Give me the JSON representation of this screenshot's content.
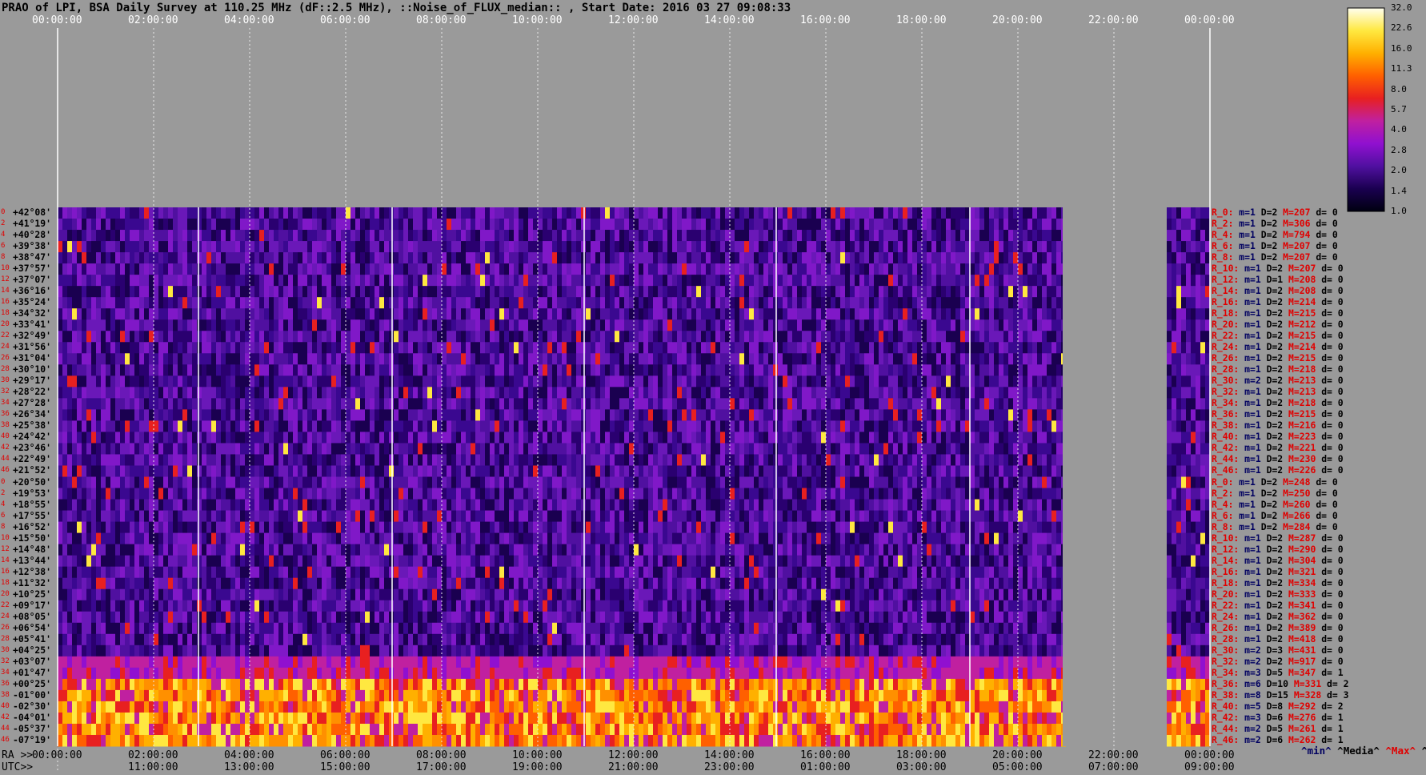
{
  "title": "PRAO of LPI, BSA Daily Survey at 110.25 MHz (dF::2.5 MHz), ::Noise_of_FLUX_median:: , Start Date: 2016 03 27 09:08:33",
  "top_axis": {
    "ticks": [
      "00:00:00",
      "02:00:00",
      "04:00:00",
      "06:00:00",
      "08:00:00",
      "10:00:00",
      "12:00:00",
      "14:00:00",
      "16:00:00",
      "18:00:00",
      "20:00:00",
      "22:00:00",
      "00:00:00"
    ]
  },
  "bottom_axis": {
    "ra_label": "RA >>",
    "utc_label": "UTC>>",
    "ra_ticks": [
      "00:00:00",
      "02:00:00",
      "04:00:00",
      "06:00:00",
      "08:00:00",
      "10:00:00",
      "12:00:00",
      "14:00:00",
      "16:00:00",
      "18:00:00",
      "20:00:00",
      "22:00:00",
      "00:00:00"
    ],
    "utc_ticks": [
      "11:00:00",
      "13:00:00",
      "15:00:00",
      "17:00:00",
      "19:00:00",
      "21:00:00",
      "23:00:00",
      "01:00:00",
      "03:00:00",
      "05:00:00",
      "07:00:00",
      "09:00:00"
    ]
  },
  "colorbar": {
    "ticks": [
      "32.0",
      "22.6",
      "16.0",
      "11.3",
      "8.0",
      "5.7",
      "4.0",
      "2.8",
      "2.0",
      "1.4",
      "1.0"
    ],
    "colors": [
      "#000010",
      "#1a0050",
      "#5010a0",
      "#9010d0",
      "#c020a0",
      "#e82020",
      "#ff6000",
      "#ffb000",
      "#ffe840",
      "#fffff0"
    ]
  },
  "stats_footer": {
    "min": "^min^",
    "median": "^Media^",
    "max": "^Max^",
    "dev": "^devia^"
  },
  "chart_data": {
    "type": "heatmap",
    "title": "PRAO of LPI, BSA Daily Survey at 110.25 MHz (dF::2.5 MHz), ::Noise_of_FLUX_median:: , Start Date: 2016 03 27 09:08:33",
    "x_axis": "RA / UTC time",
    "colorscale_range": [
      1.0,
      32.0
    ],
    "colorscale_log": true,
    "declinations": [
      "+42°08'",
      "+41°19'",
      "+40°28'",
      "+39°38'",
      "+38°47'",
      "+37°57'",
      "+37°07'",
      "+36°16'",
      "+35°24'",
      "+34°32'",
      "+33°41'",
      "+32°49'",
      "+31°56'",
      "+31°04'",
      "+30°10'",
      "+29°17'",
      "+28°22'",
      "+27°28'",
      "+26°34'",
      "+25°38'",
      "+24°42'",
      "+23°46'",
      "+22°49'",
      "+21°52'",
      "+20°50'",
      "+19°53'",
      "+18°55'",
      "+17°55'",
      "+16°52'",
      "+15°50'",
      "+14°48'",
      "+13°44'",
      "+12°38'",
      "+11°32'",
      "+10°25'",
      "+09°17'",
      "+08°05'",
      "+06°54'",
      "+05°41'",
      "+04°25'",
      "+03°07'",
      "+01°47'",
      "+00°25'",
      "-01°00'",
      "-02°30'",
      "-04°01'",
      "-05°37'",
      "-07°19'"
    ],
    "row_indices": [
      "0",
      "2",
      "4",
      "6",
      "8",
      "10",
      "12",
      "14",
      "16",
      "18",
      "20",
      "22",
      "24",
      "26",
      "28",
      "30",
      "32",
      "34",
      "36",
      "38",
      "40",
      "42",
      "44",
      "46",
      "0",
      "2",
      "4",
      "6",
      "8",
      "10",
      "12",
      "14",
      "16",
      "18",
      "20",
      "22",
      "24",
      "26",
      "28",
      "30",
      "32",
      "34",
      "36",
      "38",
      "40",
      "42",
      "44",
      "46"
    ],
    "row_stats": [
      {
        "label": "R_0:",
        "m": "m=1",
        "D": "D=2",
        "M": "M=207",
        "d": "d= 0"
      },
      {
        "label": "R_2:",
        "m": "m=1",
        "D": "D=2",
        "M": "M=306",
        "d": "d= 0"
      },
      {
        "label": "R_4:",
        "m": "m=1",
        "D": "D=2",
        "M": "M=794",
        "d": "d= 0"
      },
      {
        "label": "R_6:",
        "m": "m=1",
        "D": "D=2",
        "M": "M=207",
        "d": "d= 0"
      },
      {
        "label": "R_8:",
        "m": "m=1",
        "D": "D=2",
        "M": "M=207",
        "d": "d= 0"
      },
      {
        "label": "R_10:",
        "m": "m=1",
        "D": "D=2",
        "M": "M=207",
        "d": "d= 0"
      },
      {
        "label": "R_12:",
        "m": "m=1",
        "D": "D=1",
        "M": "M=208",
        "d": "d= 0"
      },
      {
        "label": "R_14:",
        "m": "m=1",
        "D": "D=2",
        "M": "M=208",
        "d": "d= 0"
      },
      {
        "label": "R_16:",
        "m": "m=1",
        "D": "D=2",
        "M": "M=214",
        "d": "d= 0"
      },
      {
        "label": "R_18:",
        "m": "m=1",
        "D": "D=2",
        "M": "M=215",
        "d": "d= 0"
      },
      {
        "label": "R_20:",
        "m": "m=1",
        "D": "D=2",
        "M": "M=212",
        "d": "d= 0"
      },
      {
        "label": "R_22:",
        "m": "m=1",
        "D": "D=2",
        "M": "M=215",
        "d": "d= 0"
      },
      {
        "label": "R_24:",
        "m": "m=1",
        "D": "D=2",
        "M": "M=214",
        "d": "d= 0"
      },
      {
        "label": "R_26:",
        "m": "m=1",
        "D": "D=2",
        "M": "M=215",
        "d": "d= 0"
      },
      {
        "label": "R_28:",
        "m": "m=1",
        "D": "D=2",
        "M": "M=218",
        "d": "d= 0"
      },
      {
        "label": "R_30:",
        "m": "m=2",
        "D": "D=2",
        "M": "M=213",
        "d": "d= 0"
      },
      {
        "label": "R_32:",
        "m": "m=1",
        "D": "D=2",
        "M": "M=213",
        "d": "d= 0"
      },
      {
        "label": "R_34:",
        "m": "m=1",
        "D": "D=2",
        "M": "M=218",
        "d": "d= 0"
      },
      {
        "label": "R_36:",
        "m": "m=1",
        "D": "D=2",
        "M": "M=215",
        "d": "d= 0"
      },
      {
        "label": "R_38:",
        "m": "m=1",
        "D": "D=2",
        "M": "M=216",
        "d": "d= 0"
      },
      {
        "label": "R_40:",
        "m": "m=1",
        "D": "D=2",
        "M": "M=223",
        "d": "d= 0"
      },
      {
        "label": "R_42:",
        "m": "m=1",
        "D": "D=2",
        "M": "M=221",
        "d": "d= 0"
      },
      {
        "label": "R_44:",
        "m": "m=1",
        "D": "D=2",
        "M": "M=230",
        "d": "d= 0"
      },
      {
        "label": "R_46:",
        "m": "m=1",
        "D": "D=2",
        "M": "M=226",
        "d": "d= 0"
      },
      {
        "label": "R_0:",
        "m": "m=1",
        "D": "D=2",
        "M": "M=248",
        "d": "d= 0"
      },
      {
        "label": "R_2:",
        "m": "m=1",
        "D": "D=2",
        "M": "M=250",
        "d": "d= 0"
      },
      {
        "label": "R_4:",
        "m": "m=1",
        "D": "D=2",
        "M": "M=260",
        "d": "d= 0"
      },
      {
        "label": "R_6:",
        "m": "m=1",
        "D": "D=2",
        "M": "M=266",
        "d": "d= 0"
      },
      {
        "label": "R_8:",
        "m": "m=1",
        "D": "D=2",
        "M": "M=284",
        "d": "d= 0"
      },
      {
        "label": "R_10:",
        "m": "m=1",
        "D": "D=2",
        "M": "M=287",
        "d": "d= 0"
      },
      {
        "label": "R_12:",
        "m": "m=1",
        "D": "D=2",
        "M": "M=290",
        "d": "d= 0"
      },
      {
        "label": "R_14:",
        "m": "m=1",
        "D": "D=2",
        "M": "M=304",
        "d": "d= 0"
      },
      {
        "label": "R_16:",
        "m": "m=1",
        "D": "D=2",
        "M": "M=321",
        "d": "d= 0"
      },
      {
        "label": "R_18:",
        "m": "m=1",
        "D": "D=2",
        "M": "M=334",
        "d": "d= 0"
      },
      {
        "label": "R_20:",
        "m": "m=1",
        "D": "D=2",
        "M": "M=333",
        "d": "d= 0"
      },
      {
        "label": "R_22:",
        "m": "m=1",
        "D": "D=2",
        "M": "M=341",
        "d": "d= 0"
      },
      {
        "label": "R_24:",
        "m": "m=1",
        "D": "D=2",
        "M": "M=362",
        "d": "d= 0"
      },
      {
        "label": "R_26:",
        "m": "m=1",
        "D": "D=2",
        "M": "M=389",
        "d": "d= 0"
      },
      {
        "label": "R_28:",
        "m": "m=1",
        "D": "D=2",
        "M": "M=418",
        "d": "d= 0"
      },
      {
        "label": "R_30:",
        "m": "m=2",
        "D": "D=3",
        "M": "M=431",
        "d": "d= 0"
      },
      {
        "label": "R_32:",
        "m": "m=2",
        "D": "D=2",
        "M": "M=917",
        "d": "d= 0"
      },
      {
        "label": "R_34:",
        "m": "m=3",
        "D": "D=5",
        "M": "M=347",
        "d": "d= 1"
      },
      {
        "label": "R_36:",
        "m": "m=6",
        "D": "D=10",
        "M": "M=331",
        "d": "d= 2"
      },
      {
        "label": "R_38:",
        "m": "m=8",
        "D": "D=15",
        "M": "M=328",
        "d": "d= 3"
      },
      {
        "label": "R_40:",
        "m": "m=5",
        "D": "D=8",
        "M": "M=292",
        "d": "d= 2"
      },
      {
        "label": "R_42:",
        "m": "m=3",
        "D": "D=6",
        "M": "M=276",
        "d": "d= 1"
      },
      {
        "label": "R_44:",
        "m": "m=2",
        "D": "D=5",
        "M": "M=261",
        "d": "d= 1"
      },
      {
        "label": "R_46:",
        "m": "m=2",
        "D": "D=6",
        "M": "M=262",
        "d": "d= 1"
      }
    ]
  }
}
